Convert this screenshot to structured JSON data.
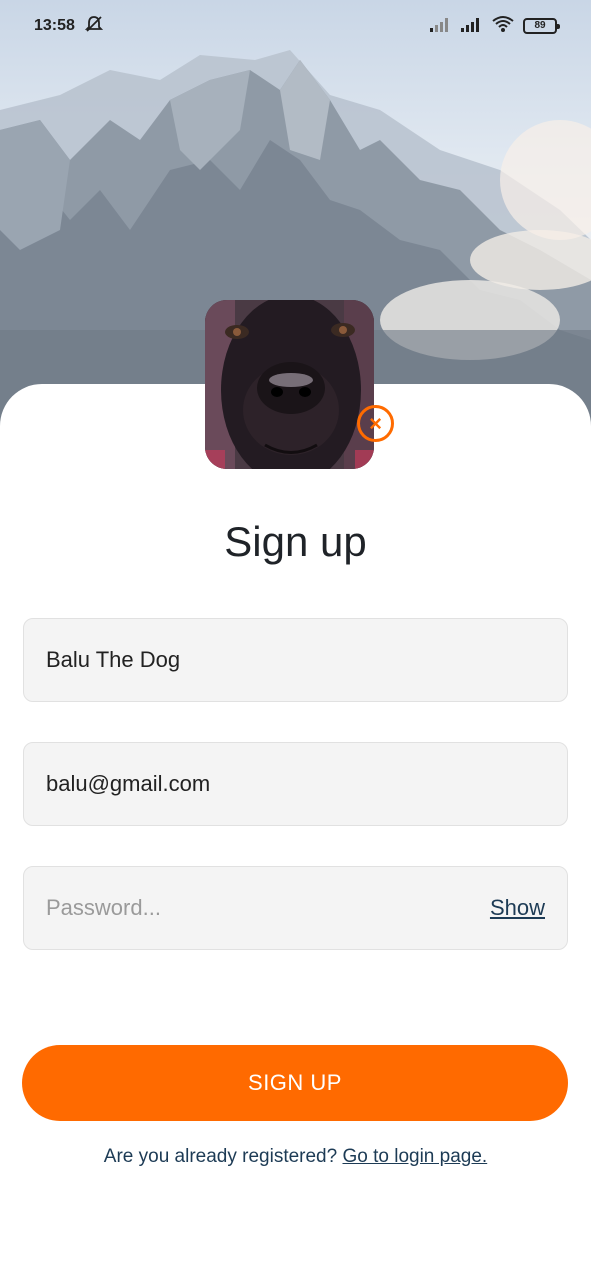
{
  "status_bar": {
    "time": "13:58",
    "battery": "89"
  },
  "header": {
    "title": "Sign up"
  },
  "form": {
    "name_value": "Balu The Dog",
    "email_value": "balu@gmail.com",
    "password_value": "",
    "password_placeholder": "Password...",
    "show_label": "Show"
  },
  "actions": {
    "signup_label": "SIGN UP",
    "remove_avatar_symbol": "×"
  },
  "footer": {
    "prompt_text": "Are you already registered?",
    "login_link": "Go to login page."
  },
  "colors": {
    "accent": "#ff6a00",
    "link": "#1d3b55",
    "field_bg": "#f4f4f4"
  },
  "icons": [
    "silent-alarm-icon",
    "signal-icon",
    "wifi-icon",
    "battery-icon",
    "close-circle-icon"
  ]
}
